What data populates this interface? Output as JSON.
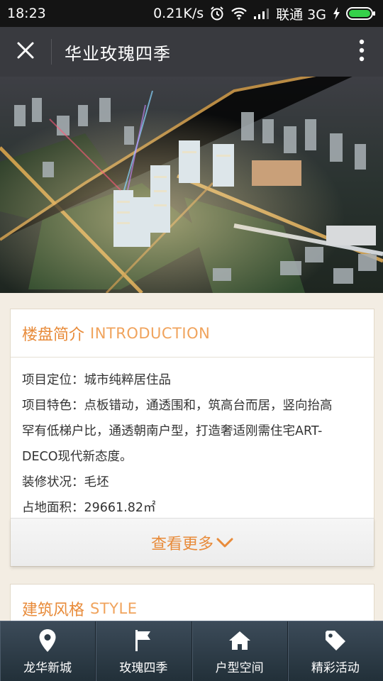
{
  "status_bar": {
    "time": "18:23",
    "net_speed": "0.21K/s",
    "carrier": "联通 3G",
    "icons": [
      "alarm-icon",
      "wifi-icon",
      "signal-icon",
      "charging-icon",
      "battery-icon"
    ]
  },
  "header": {
    "title": "华业玫瑰四季",
    "close_icon": "close-icon",
    "more_icon": "more-vertical-icon"
  },
  "hero": {
    "description_icon": "aerial-photo"
  },
  "intro_card": {
    "title_cn": "楼盘简介",
    "title_en": "INTRODUCTION",
    "lines": [
      "项目定位：城市纯粹居住品",
      "项目特色：点板错动，通透围和，筑高台而居，竖向抬高",
      "罕有低梯户比，通透朝南户型，打造奢适刚需住宅ART-",
      "DECO现代新态度。",
      "装修状况：毛坯",
      "占地面积：29661.82㎡"
    ],
    "more_label": "查看更多"
  },
  "style_card": {
    "title_cn": "建筑风格",
    "title_en": "STYLE"
  },
  "bottom_nav": [
    {
      "label": "龙华新城",
      "icon": "location-pin-icon"
    },
    {
      "label": "玫瑰四季",
      "icon": "flag-icon"
    },
    {
      "label": "户型空间",
      "icon": "home-icon"
    },
    {
      "label": "精彩活动",
      "icon": "tag-icon"
    }
  ],
  "colors": {
    "accent": "#e88b3a",
    "titlebar": "#393a3f",
    "statusbar": "#141414",
    "page_bg": "#f3ede3",
    "nav_bg": "#2e3c48"
  }
}
